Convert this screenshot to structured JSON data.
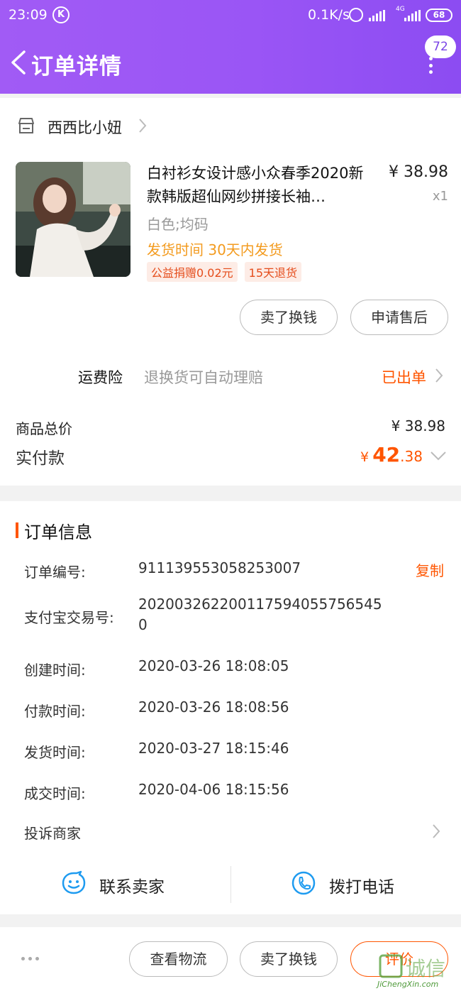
{
  "status_bar": {
    "time": "23:09",
    "app_badge": "K",
    "net_speed": "0.1K/s",
    "net_type": "4G",
    "battery": "68"
  },
  "header": {
    "title": "订单详情",
    "message_badge": "72",
    "background_color": "#9a55f5"
  },
  "shop": {
    "name": "西西比小妞"
  },
  "product": {
    "title": "白衬衫女设计感小众春季2020新款韩版超仙网纱拼接长袖…",
    "price": "¥ 38.98",
    "quantity": "x1",
    "sku": "白色;均码",
    "ship_time": "发货时间 30天内发货",
    "tags": [
      "公益捐赠0.02元",
      "15天退货"
    ]
  },
  "item_actions": {
    "sell_label": "卖了换钱",
    "after_sale_label": "申请售后"
  },
  "insurance": {
    "label": "运费险",
    "desc": "退换货可自动理赔",
    "status": "已出单"
  },
  "totals": {
    "goods_total_label": "商品总价",
    "goods_total_value": "¥ 38.98",
    "paid_label": "实付款",
    "paid_currency": "¥",
    "paid_int": "42",
    "paid_dec": ".38"
  },
  "order_info": {
    "section_title": "订单信息",
    "copy_label": "复制",
    "rows": [
      {
        "label": "订单编号:",
        "value": "911139553058253007"
      },
      {
        "label": "支付宝交易号:",
        "value": "2020032622001175940557565450"
      },
      {
        "label": "创建时间:",
        "value": "2020-03-26 18:08:05"
      },
      {
        "label": "付款时间:",
        "value": "2020-03-26 18:08:56"
      },
      {
        "label": "发货时间:",
        "value": "2020-03-27 18:15:46"
      },
      {
        "label": "成交时间:",
        "value": "2020-04-06 18:15:56"
      }
    ],
    "complain_label": "投诉商家"
  },
  "contact": {
    "chat_label": "联系卖家",
    "phone_label": "拨打电话"
  },
  "bottom_bar": {
    "logistics_label": "查看物流",
    "sell_label": "卖了换钱",
    "rate_label": "评价"
  },
  "watermark": {
    "text": "诚信",
    "url": "JiChengXin.com"
  },
  "colors": {
    "accent": "#ff5500",
    "ship_time": "#f39b1f",
    "header_purple": "#9a55f5"
  }
}
